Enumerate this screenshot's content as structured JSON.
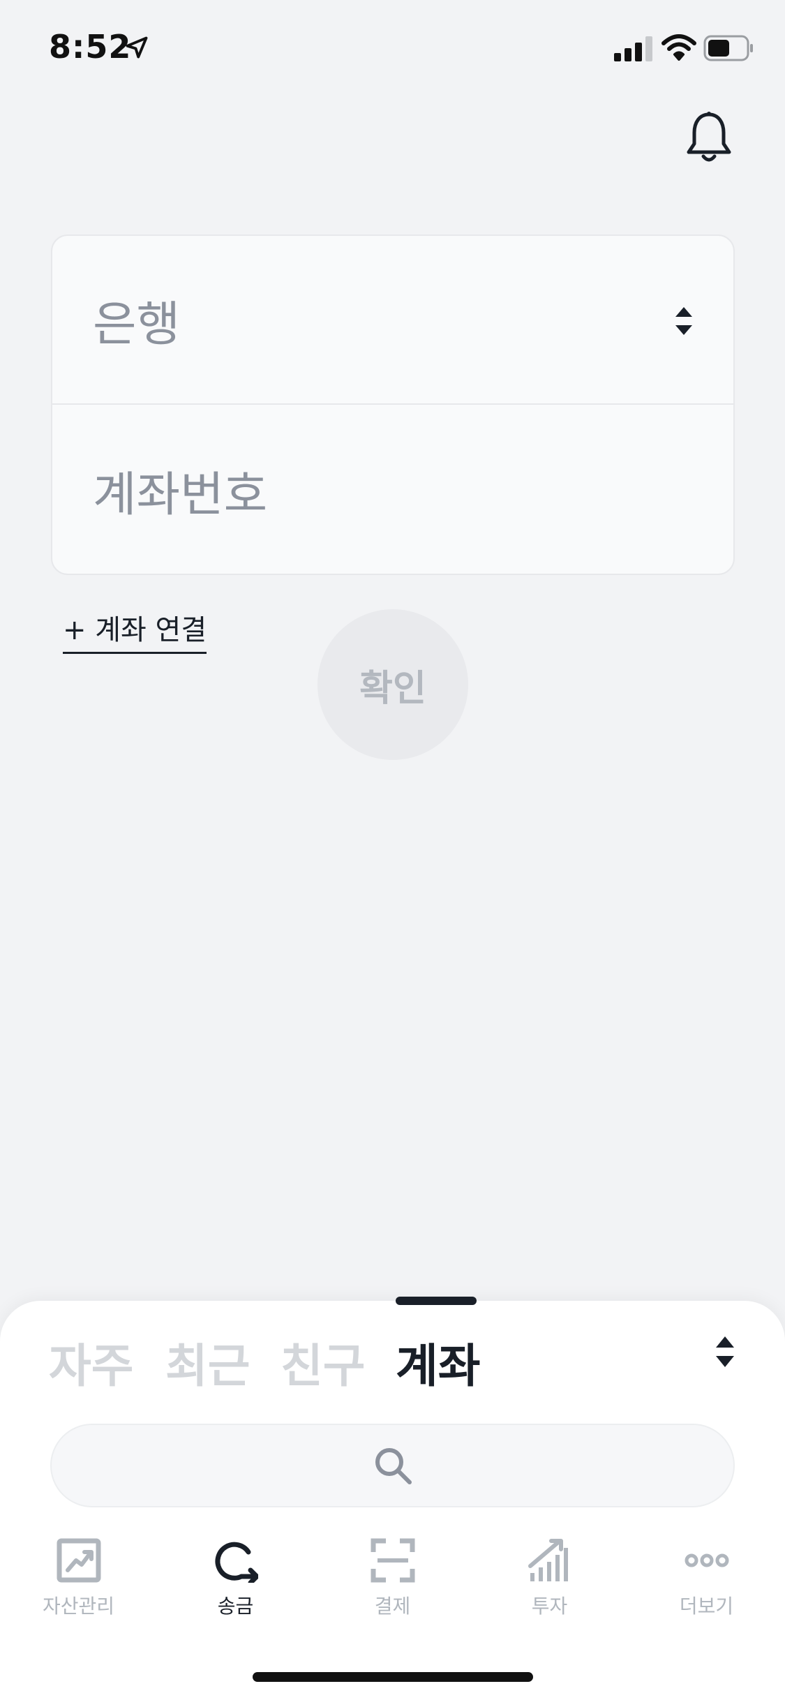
{
  "status_bar": {
    "time": "8:52"
  },
  "form": {
    "bank_placeholder": "은행",
    "account_placeholder": "계좌번호"
  },
  "add_account_link": "+ 계좌 연결",
  "confirm_button": "확인",
  "sheet": {
    "tabs": [
      {
        "label": "자주",
        "active": false
      },
      {
        "label": "최근",
        "active": false
      },
      {
        "label": "친구",
        "active": false
      },
      {
        "label": "계좌",
        "active": true
      }
    ]
  },
  "bottom_nav": {
    "items": [
      {
        "label": "자산관리",
        "icon": "chart-frame-icon",
        "active": false
      },
      {
        "label": "송금",
        "icon": "transfer-arrow-icon",
        "active": true
      },
      {
        "label": "결제",
        "icon": "scan-frame-icon",
        "active": false
      },
      {
        "label": "투자",
        "icon": "signal-bars-icon",
        "active": false
      },
      {
        "label": "더보기",
        "icon": "more-dots-icon",
        "active": false
      }
    ]
  },
  "colors": {
    "background": "#f2f3f5",
    "text_primary": "#191f28",
    "text_placeholder": "#8b919c",
    "inactive": "#b0b6bd"
  }
}
